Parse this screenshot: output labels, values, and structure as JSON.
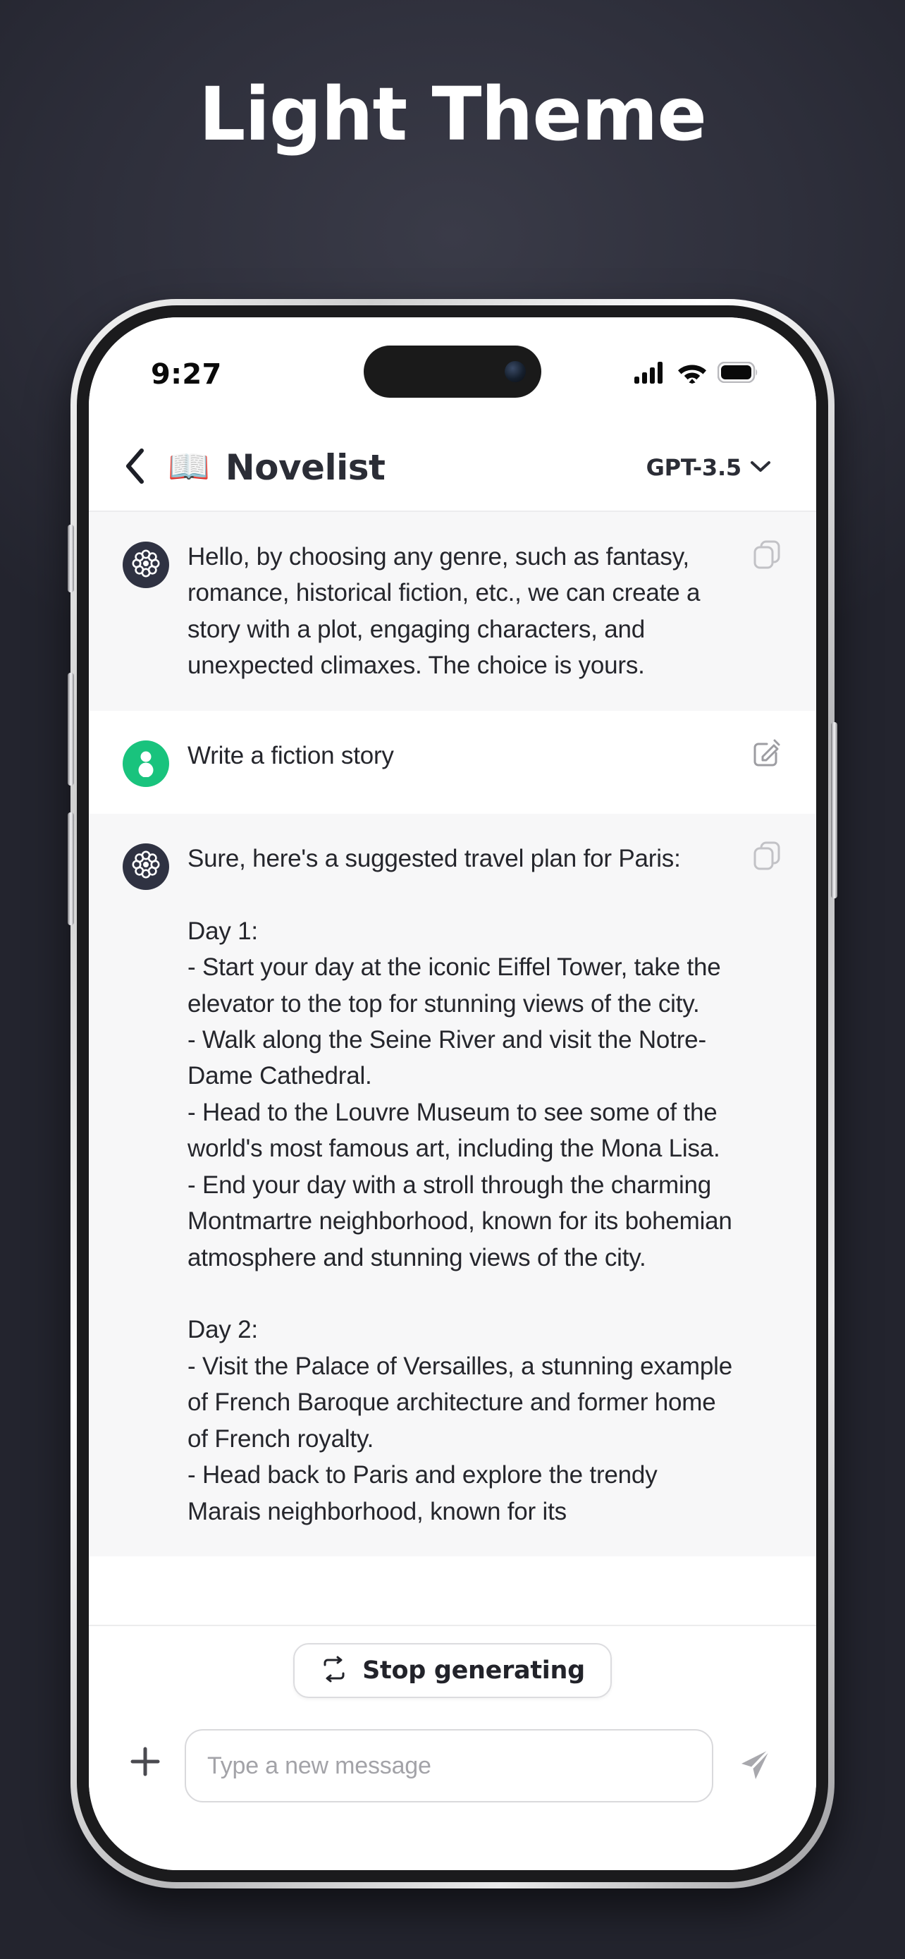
{
  "poster": {
    "title": "Light Theme",
    "background_color": "#2e2f3b",
    "title_color": "#ffffff"
  },
  "status_bar": {
    "time": "9:27",
    "icons": [
      "cellular-signal-icon",
      "wifi-icon",
      "battery-icon"
    ],
    "battery_level": "100"
  },
  "header": {
    "back_icon": "chevron-left-icon",
    "emoji": "📖",
    "title": "Novelist",
    "model": "GPT-3.5",
    "model_chevron_icon": "chevron-down-icon"
  },
  "messages": [
    {
      "role": "assistant",
      "avatar": "openai-rosette-icon",
      "action_icon": "copy-icon",
      "text": "Hello, by choosing any genre, such as fantasy, romance, historical fiction, etc., we can create a story with a plot, engaging characters, and unexpected climaxes. The choice is yours."
    },
    {
      "role": "user",
      "avatar": "user-person-icon",
      "action_icon": "edit-pencil-icon",
      "text": "Write a fiction story"
    },
    {
      "role": "assistant",
      "avatar": "openai-rosette-icon",
      "action_icon": "copy-icon",
      "text": "Sure, here's a suggested travel plan for Paris:\n\nDay 1:\n- Start your day at the iconic Eiffel Tower, take the elevator to the top for stunning views of the city.\n- Walk along the Seine River and visit the Notre-Dame Cathedral.\n- Head to the Louvre Museum to see some of the world's most famous art, including the Mona Lisa.\n- End your day with a stroll through the charming Montmartre neighborhood, known for its bohemian atmosphere and stunning views of the city.\n\nDay 2:\n- Visit the Palace of Versailles, a stunning example of French Baroque architecture and former home of French royalty.\n- Head back to Paris and explore the trendy Marais neighborhood, known for its"
    }
  ],
  "stop_generating": {
    "label": "Stop generating",
    "icon": "regenerate-arrows-icon"
  },
  "composer": {
    "plus_icon": "plus-icon",
    "placeholder": "Type a new message",
    "value": "",
    "send_icon": "send-paper-plane-icon"
  },
  "colors": {
    "user_avatar": "#19c37d",
    "assistant_avatar": "#2f3242",
    "assistant_row_bg": "#f7f7f8",
    "user_row_bg": "#ffffff"
  }
}
